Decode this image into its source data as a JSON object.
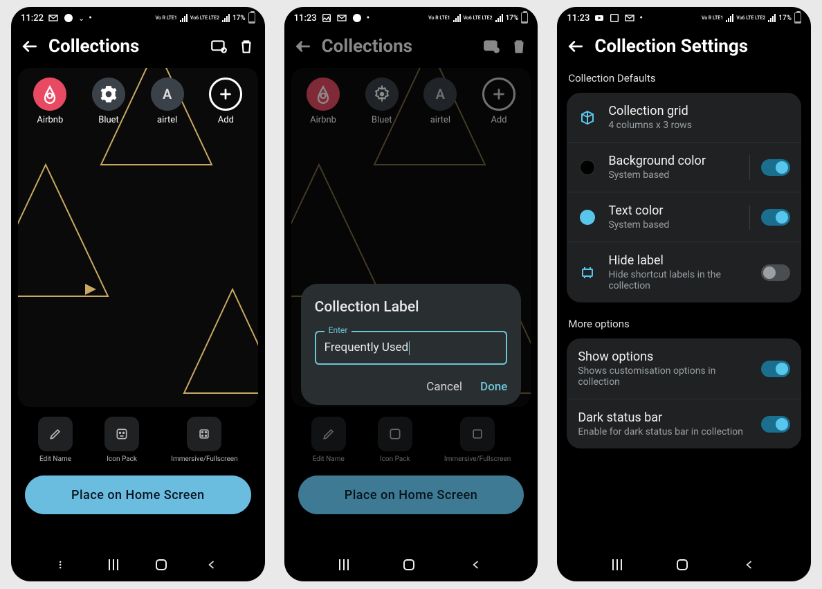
{
  "screens": [
    {
      "statusbar": {
        "time": "11:22",
        "battery": "17%",
        "net1": "Vo R LTE1",
        "net2": "Vo6 LTE LTE2"
      },
      "appbar": {
        "title": "Collections"
      },
      "apps": [
        {
          "name": "Airbnb",
          "label": "Airbnb",
          "bg": "#e84a64",
          "type": "airbnb"
        },
        {
          "name": "Bluet",
          "label": "Bluet",
          "bg": "#3b4148",
          "type": "gear"
        },
        {
          "name": "airtel",
          "label": "airtel",
          "bg": "#3b4148",
          "type": "A"
        },
        {
          "name": "Add",
          "label": "Add",
          "bg": "#fff",
          "type": "plus"
        }
      ],
      "tools": [
        {
          "label": "Edit Name",
          "icon": "pencil"
        },
        {
          "label": "Icon Pack",
          "icon": "sticker"
        },
        {
          "label": "Immersive/Fullscreen",
          "icon": "grid"
        }
      ],
      "button": {
        "label": "Place on Home Screen",
        "bg": "#6bbde0",
        "fg": "#0a1520"
      }
    },
    {
      "statusbar": {
        "time": "11:23",
        "battery": "17%",
        "net1": "Vo R LTE1",
        "net2": "Vo6 LTE LTE2"
      },
      "appbar": {
        "title": "Collections",
        "dim": true
      },
      "apps": [
        {
          "name": "Airbnb",
          "label": "Airbnb",
          "bg": "#7d3542",
          "type": "airbnb"
        },
        {
          "name": "Bluet",
          "label": "Bluet",
          "bg": "#2b3035",
          "type": "gear"
        },
        {
          "name": "airtel",
          "label": "airtel",
          "bg": "#2b3035",
          "type": "A"
        },
        {
          "name": "Add",
          "label": "Add",
          "bg": "#888",
          "type": "plus"
        }
      ],
      "dialog": {
        "title": "Collection Label",
        "legend": "Enter",
        "value": "Frequently Used",
        "cancel": "Cancel",
        "done": "Done"
      },
      "tools": [
        {
          "label": "Edit Name",
          "icon": "pencil"
        },
        {
          "label": "Icon Pack",
          "icon": "sticker"
        },
        {
          "label": "Immersive/Fullscreen",
          "icon": "grid"
        }
      ],
      "button": {
        "label": "Place on Home Screen",
        "bg": "#3f7a94",
        "fg": "#0a1520"
      }
    },
    {
      "statusbar": {
        "time": "11:23",
        "battery": "17%",
        "net1": "Vo R LTE1",
        "net2": "Vo6 LTE LTE2"
      },
      "appbar": {
        "title": "Collection Settings"
      },
      "section1": "Collection Defaults",
      "rows1": [
        {
          "title": "Collection grid",
          "sub": "4 columns x 3 rows",
          "icon": "cube",
          "toggle": null
        },
        {
          "title": "Background color",
          "sub": "System based",
          "icon": "dot-black",
          "toggle": "on"
        },
        {
          "title": "Text color",
          "sub": "System based",
          "icon": "dot-cyan",
          "toggle": "on"
        },
        {
          "title": "Hide label",
          "sub": "Hide shortcut labels in the collection",
          "icon": "label",
          "toggle": "off"
        }
      ],
      "section2": "More options",
      "rows2": [
        {
          "title": "Show options",
          "sub": "Shows customisation options in collection",
          "toggle": "on"
        },
        {
          "title": "Dark status bar",
          "sub": "Enable for dark status bar in collection",
          "toggle": "on"
        }
      ]
    }
  ],
  "colors": {
    "accent": "#58c6eb"
  }
}
